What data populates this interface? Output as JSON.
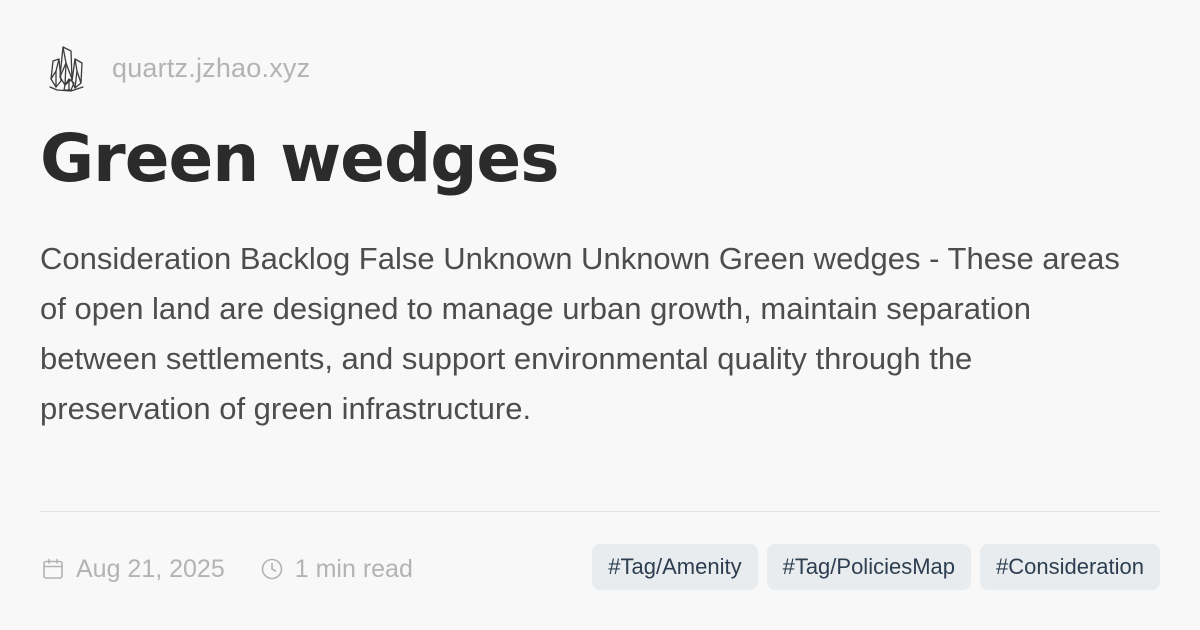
{
  "site": {
    "logo_icon": "crystal-cluster-icon",
    "name": "quartz.jzhao.xyz"
  },
  "page": {
    "title": "Green wedges",
    "description": "Consideration Backlog False Unknown Unknown Green wedges - These areas of open land are designed to manage urban growth, maintain separation between settlements, and support environmental quality through the preservation of green infrastructure."
  },
  "meta": {
    "date_icon": "calendar-icon",
    "date": "Aug 21, 2025",
    "reading_time_icon": "clock-icon",
    "reading_time": "1 min read"
  },
  "tags": [
    {
      "label": "#Tag/Amenity"
    },
    {
      "label": "#Tag/PoliciesMap"
    },
    {
      "label": "#Consideration"
    }
  ],
  "colors": {
    "background": "#f8f8f9",
    "title": "#2b2b2b",
    "description": "#4d4d50",
    "muted": "#b3b3b6",
    "tag_background": "#e9ecef",
    "tag_text": "#2c3e50"
  }
}
